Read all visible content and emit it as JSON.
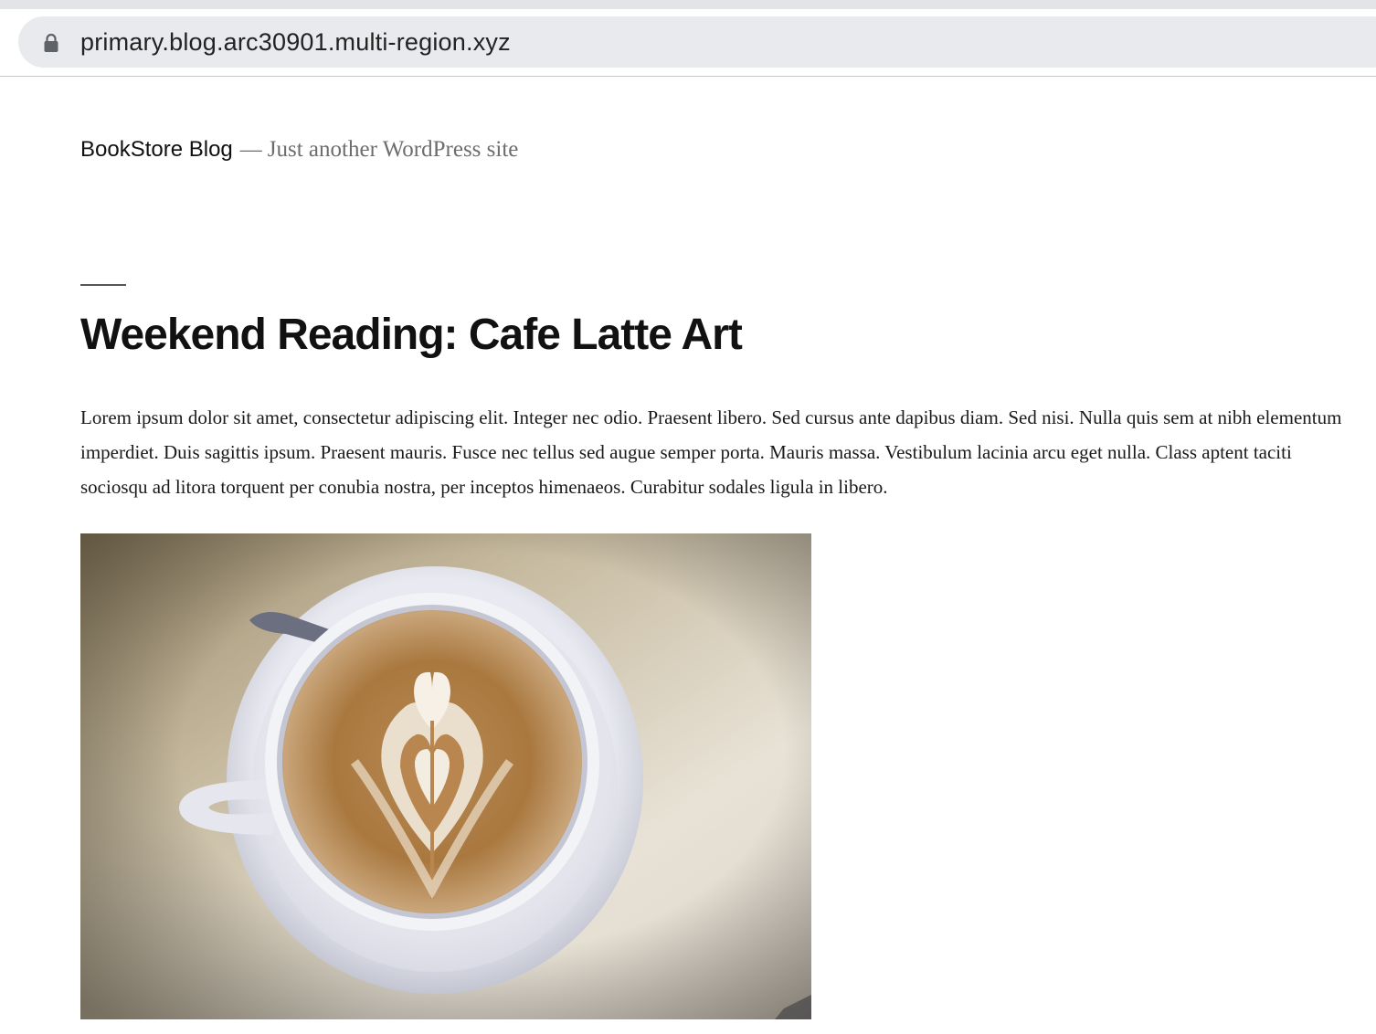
{
  "browser": {
    "url": "primary.blog.arc30901.multi-region.xyz",
    "lock_icon": "lock-icon"
  },
  "site": {
    "title": "BookStore Blog",
    "separator": "—",
    "tagline": "Just another WordPress site"
  },
  "post": {
    "title": "Weekend Reading: Cafe Latte Art",
    "body": "Lorem ipsum dolor sit amet, consectetur adipiscing elit. Integer nec odio. Praesent libero. Sed cursus ante dapibus diam. Sed nisi. Nulla quis sem at nibh elementum imperdiet. Duis sagittis ipsum. Praesent mauris. Fusce nec tellus sed augue semper porta. Mauris massa. Vestibulum lacinia arcu eget nulla. Class aptent taciti sociosqu ad litora torquent per conubia nostra, per inceptos himenaeos. Curabitur sodales ligula in libero.",
    "image_subject": "latte-art-coffee-cup-image"
  },
  "colors": {
    "url_bar_bg": "#e9eaed",
    "text_primary": "#111111",
    "text_muted": "#6d6d6d"
  }
}
